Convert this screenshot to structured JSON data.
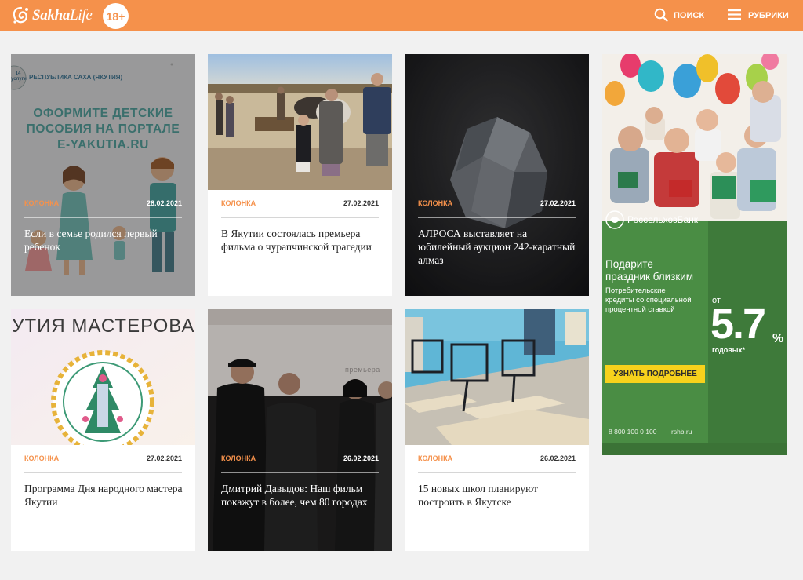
{
  "header": {
    "logo_part1": "Sakha",
    "logo_part2": "Life",
    "age_badge": "18+",
    "search_label": "ПОИСК",
    "rubrics_label": "РУБРИКИ"
  },
  "colors": {
    "accent": "#f5914b",
    "ad_green": "#3f7a3a",
    "ad_yellow": "#f7d21c"
  },
  "cards": [
    {
      "category": "КОЛОНКА",
      "date": "28.02.2021",
      "title": "Если в семье родился первый ребенок",
      "image_text": {
        "region": "РЕСПУБЛИКА САХА (ЯКУТИЯ)",
        "badge": "14 услуги",
        "line1": "ОФОРМИТЕ ДЕТСКИЕ",
        "line2": "ПОСОБИЯ НА ПОРТАЛЕ",
        "line3": "E-YAKUTIA.RU"
      }
    },
    {
      "category": "КОЛОНКА",
      "date": "27.02.2021",
      "title": "В Якутии состоялась премьера фильма о чурапчинской трагедии"
    },
    {
      "category": "КОЛОНКА",
      "date": "27.02.2021",
      "title": "АЛРОСА выставляет на юбилейный аукцион 242-каратный алмаз"
    },
    {
      "category": "КОЛОНКА",
      "date": "27.02.2021",
      "title": "Программа Дня народного мастера Якутии",
      "image_text": {
        "banner": "КУТИЯ МАСТЕРОВА"
      }
    },
    {
      "category": "КОЛОНКА",
      "date": "26.02.2021",
      "title": "Дмитрий Давыдов: Наш фильм покажут в более, чем 80 городах",
      "image_text": {
        "wall": "премьера"
      }
    },
    {
      "category": "КОЛОНКА",
      "date": "26.02.2021",
      "title": "15 новых школ планируют построить в Якутске"
    }
  ],
  "ad": {
    "bank_name": "РоссельхозБанк",
    "headline1": "Подарите",
    "headline2": "праздник близким",
    "subtext1": "Потребительские",
    "subtext2": "кредиты со специальной",
    "subtext3": "процентной ставкой",
    "rate_from": "от",
    "rate_value": "5.7",
    "rate_unit": "%",
    "rate_suffix": "годовых*",
    "cta": "УЗНАТЬ ПОДРОБНЕЕ",
    "phone": "8 800 100 0 100",
    "site": "rshb.ru"
  }
}
